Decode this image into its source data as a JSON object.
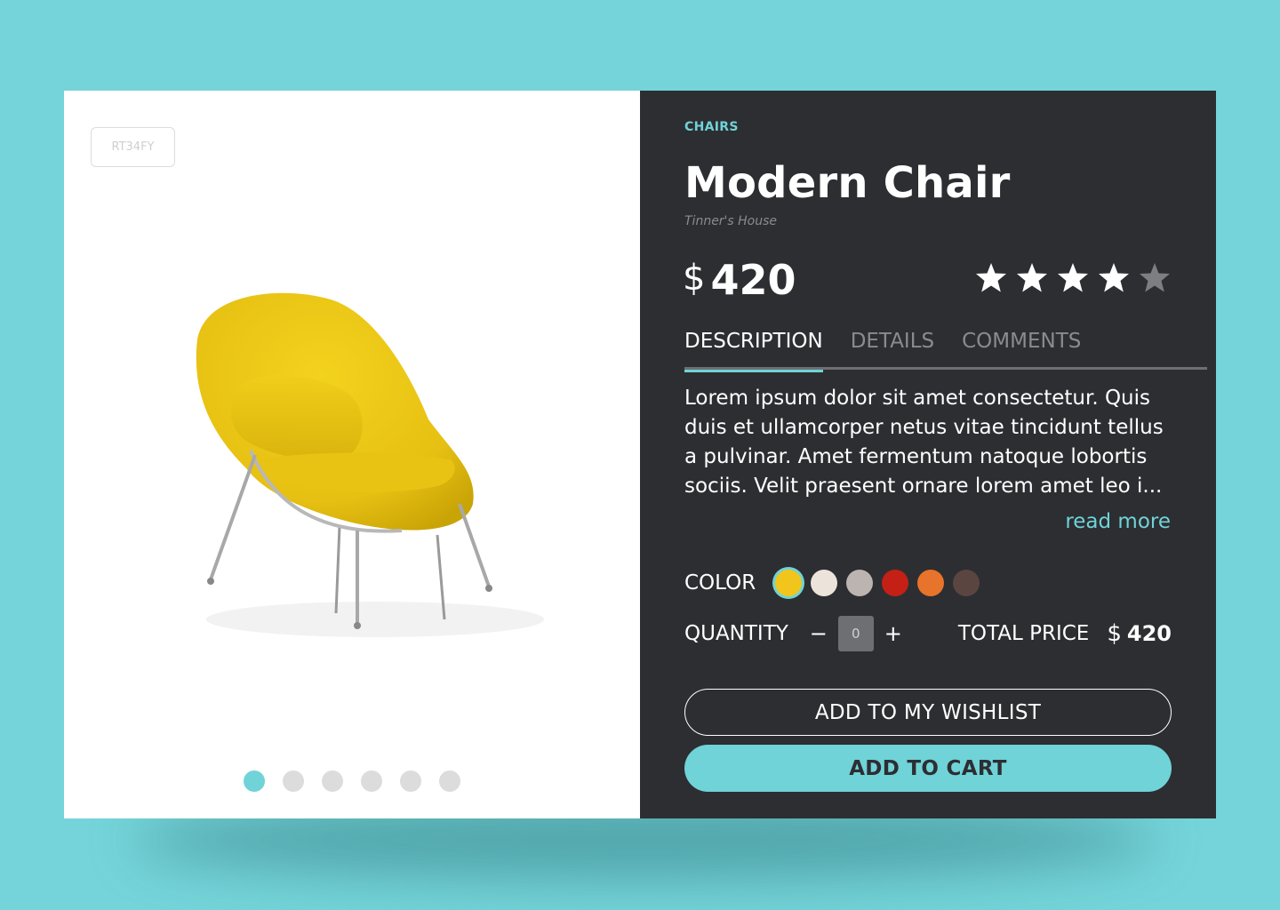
{
  "product": {
    "sku": "RT34FY",
    "category": "CHAIRS",
    "name": "Modern Chair",
    "brand": "Tinner's House",
    "price_currency": "$",
    "price": "420",
    "rating": 4,
    "rating_max": 5
  },
  "gallery": {
    "image": "chair-image",
    "slide_count": 6,
    "active_slide": 0
  },
  "tabs": [
    {
      "label": "DESCRIPTION",
      "active": true
    },
    {
      "label": "DETAILS",
      "active": false
    },
    {
      "label": "COMMENTS",
      "active": false
    }
  ],
  "description": {
    "text": "Lorem ipsum dolor sit amet consectetur. Quis duis et ullamcorper netus vitae tincidunt tellus a pulvinar. Amet fermentum natoque lobortis sociis. Velit praesent ornare lorem amet leo i...",
    "read_more": "read more"
  },
  "color": {
    "label": "COLOR",
    "options": [
      "#f1c51b",
      "#ece4db",
      "#bcb4b0",
      "#c42016",
      "#e8732a",
      "#5b4541"
    ],
    "selected": 0
  },
  "quantity": {
    "label": "QUANTITY",
    "minus": "−",
    "plus": "+",
    "value": "0"
  },
  "total": {
    "label": "TOTAL PRICE",
    "currency": "$",
    "value": "420"
  },
  "buttons": {
    "wishlist": "ADD TO MY WISHLIST",
    "cart": "ADD TO CART"
  },
  "colors": {
    "background": "#74d4d9",
    "accent": "#6fd3d8",
    "panel": "#2d2e32",
    "star_filled": "#ffffff",
    "star_empty": "#7d7e82"
  }
}
